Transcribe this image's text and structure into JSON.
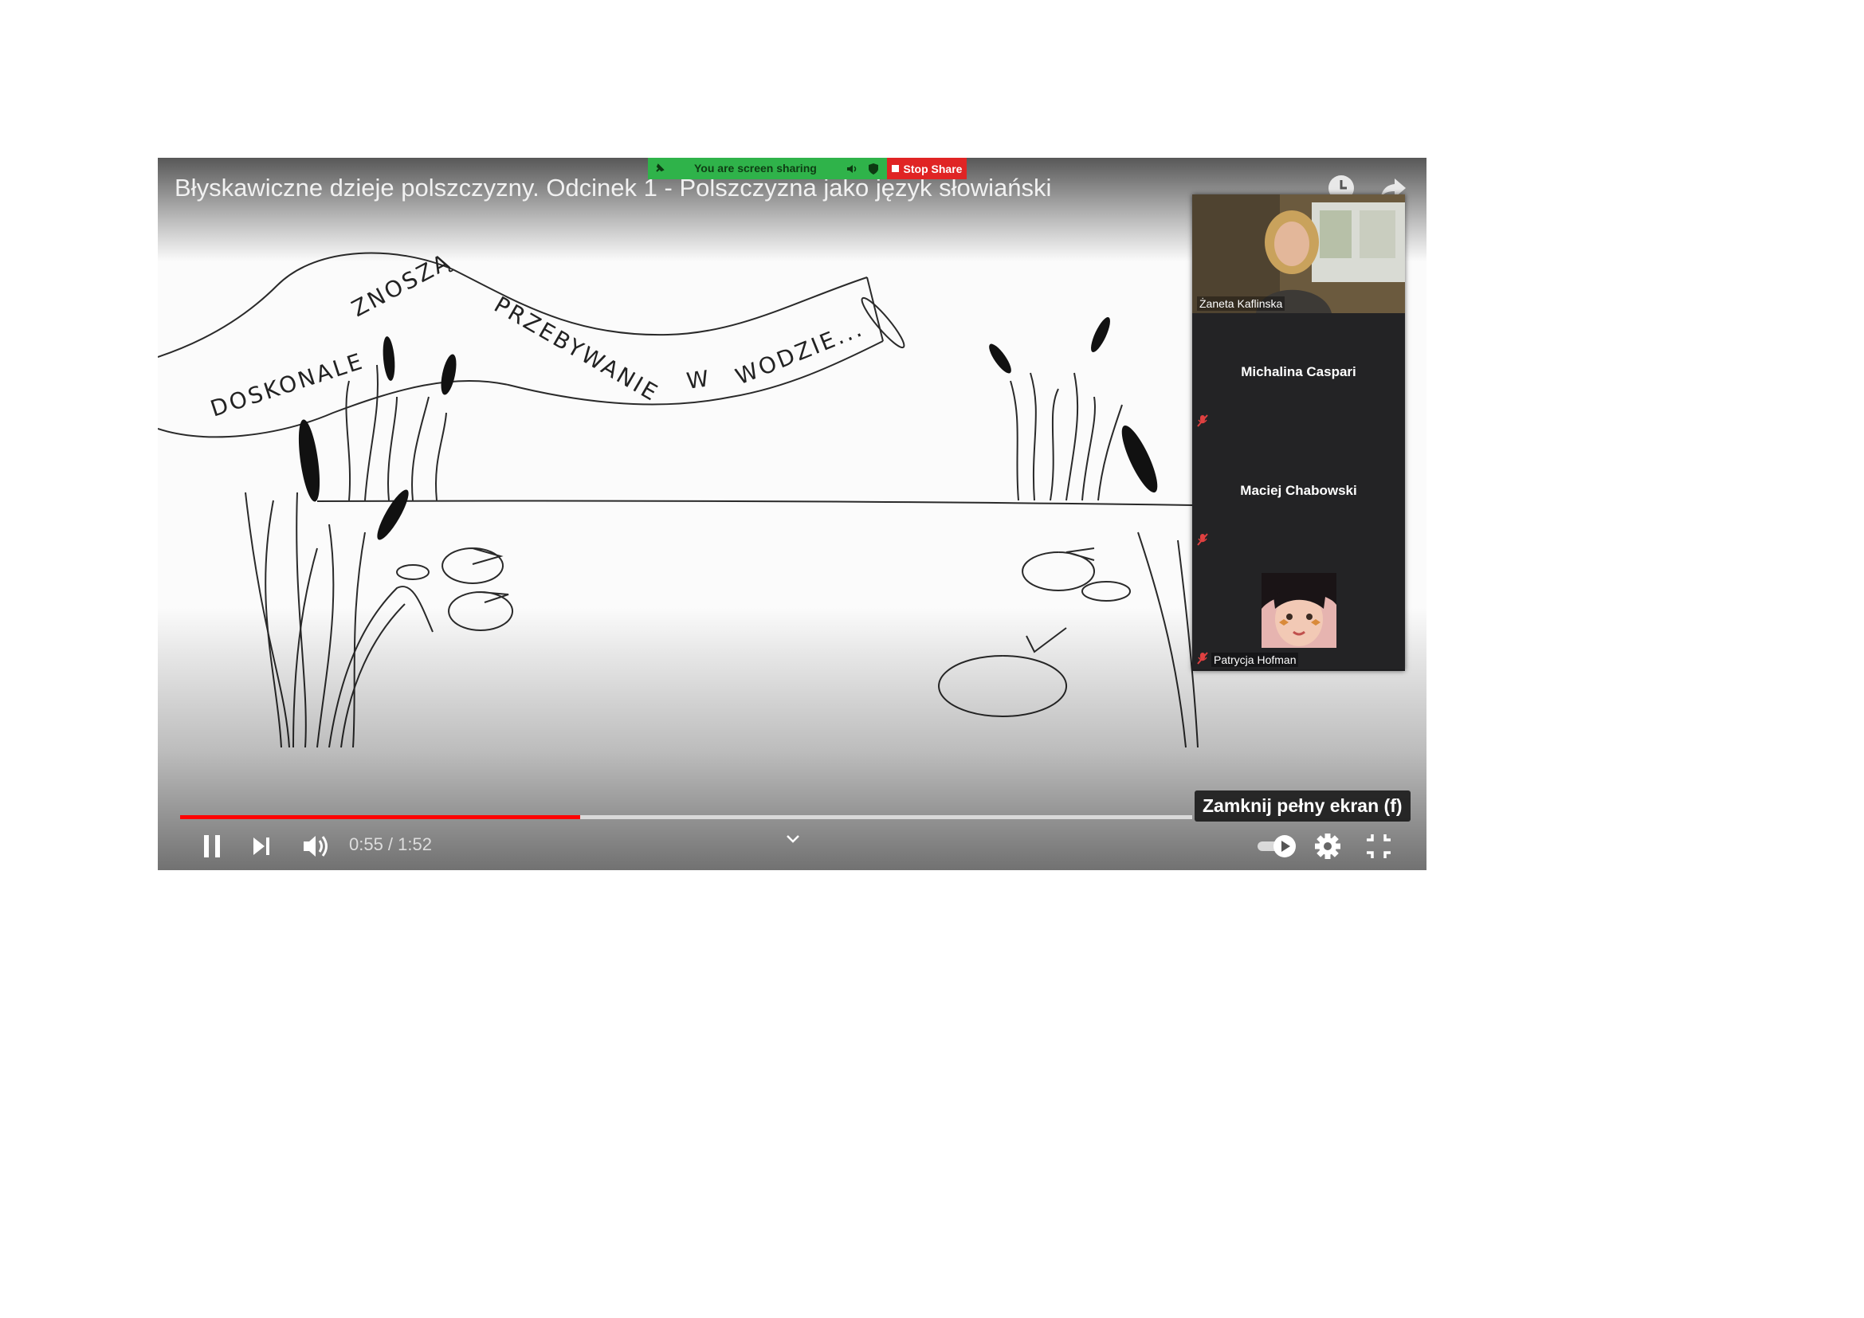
{
  "video": {
    "title": "Błyskawiczne dzieje polszczyzny. Odcinek 1 - Polszczyzna jako język słowiański",
    "banner_text": "DOSKONALE ZNOSZĄ PRZEBYWANIE W WODZIE...",
    "progress_fraction": 0.395
  },
  "zoom": {
    "sharing_label": "You are screen sharing",
    "stop_share_label": "Stop Share",
    "green_color": "#2fb34a",
    "red_color": "#e02424"
  },
  "participants": [
    {
      "name": "Żaneta Kaflinska",
      "video": true
    },
    {
      "name": "Michalina Caspari",
      "video": false,
      "muted": true
    },
    {
      "name": "Maciej Chabowski",
      "video": false,
      "muted": true
    },
    {
      "name": "Patrycja Hofman",
      "video": true,
      "muted": true
    }
  ],
  "controls": {
    "time_current": "0:55",
    "time_total": "1:52",
    "time_display": "0:55 / 1:52",
    "tooltip": "Zamknij pełny ekran (f)",
    "icons": [
      "pause-icon",
      "next-icon",
      "volume-icon",
      "chevron-down-icon",
      "autoplay-toggle",
      "settings-icon",
      "exit-fullscreen-icon"
    ]
  }
}
